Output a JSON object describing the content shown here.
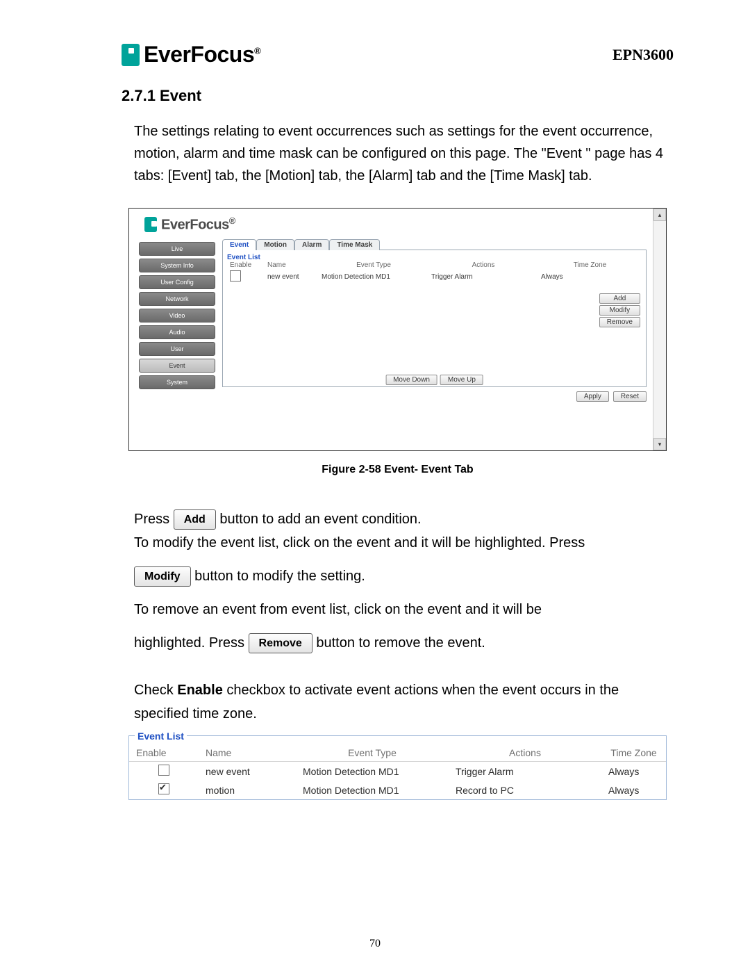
{
  "header": {
    "brand": "EverFocus",
    "trademark": "®",
    "model": "EPN3600"
  },
  "heading": "2.7.1   Event",
  "intro_paragraph": "The settings relating to event occurrences such as settings for the event occurrence, motion, alarm and time mask can be configured on this page. The \"Event \" page has 4 tabs: [Event] tab, the [Motion] tab, the [Alarm] tab and the [Time Mask] tab.",
  "screenshot": {
    "nav_items": [
      "Live",
      "System Info",
      "User Config",
      "Network",
      "Video",
      "Audio",
      "User",
      "Event",
      "System"
    ],
    "nav_active_index": 7,
    "tabs": [
      "Event",
      "Motion",
      "Alarm",
      "Time Mask"
    ],
    "active_tab_index": 0,
    "fieldset_title": "Event List",
    "columns": [
      "Enable",
      "Name",
      "Event Type",
      "Actions",
      "Time Zone"
    ],
    "row": {
      "enable_checked": false,
      "name": "new event",
      "event_type": "Motion Detection MD1",
      "actions": "Trigger Alarm",
      "time_zone": "Always"
    },
    "side_buttons": [
      "Add",
      "Modify",
      "Remove"
    ],
    "move_buttons": [
      "Move Down",
      "Move Up"
    ],
    "footer_buttons": [
      "Apply",
      "Reset"
    ]
  },
  "figure_caption": "Figure 2-58 Event- Event Tab",
  "instructions": {
    "press_prefix": "Press  ",
    "add_label": "Add",
    "add_suffix": "  button to add an event condition.",
    "modify_intro": "To modify the event list, click on the event and it will be highlighted. Press",
    "modify_label": "Modify",
    "modify_suffix": "  button to modify the setting.",
    "remove_intro": "To remove an event from event list, click on the event and it will be",
    "remove_prefix": "highlighted. Press  ",
    "remove_label": "Remove",
    "remove_suffix": "  button to remove the event.",
    "enable_sentence_pre": "Check ",
    "enable_word": "Enable",
    "enable_sentence_post": " checkbox to activate event actions when the event occurs in the specified time zone."
  },
  "event_list_figure": {
    "title": "Event List",
    "columns": [
      "Enable",
      "Name",
      "Event Type",
      "Actions",
      "Time Zone"
    ],
    "rows": [
      {
        "enable_checked": false,
        "name": "new event",
        "event_type": "Motion Detection MD1",
        "actions": "Trigger Alarm",
        "time_zone": "Always"
      },
      {
        "enable_checked": true,
        "name": "motion",
        "event_type": "Motion Detection MD1",
        "actions": "Record to PC",
        "time_zone": "Always"
      }
    ]
  },
  "page_number": "70"
}
